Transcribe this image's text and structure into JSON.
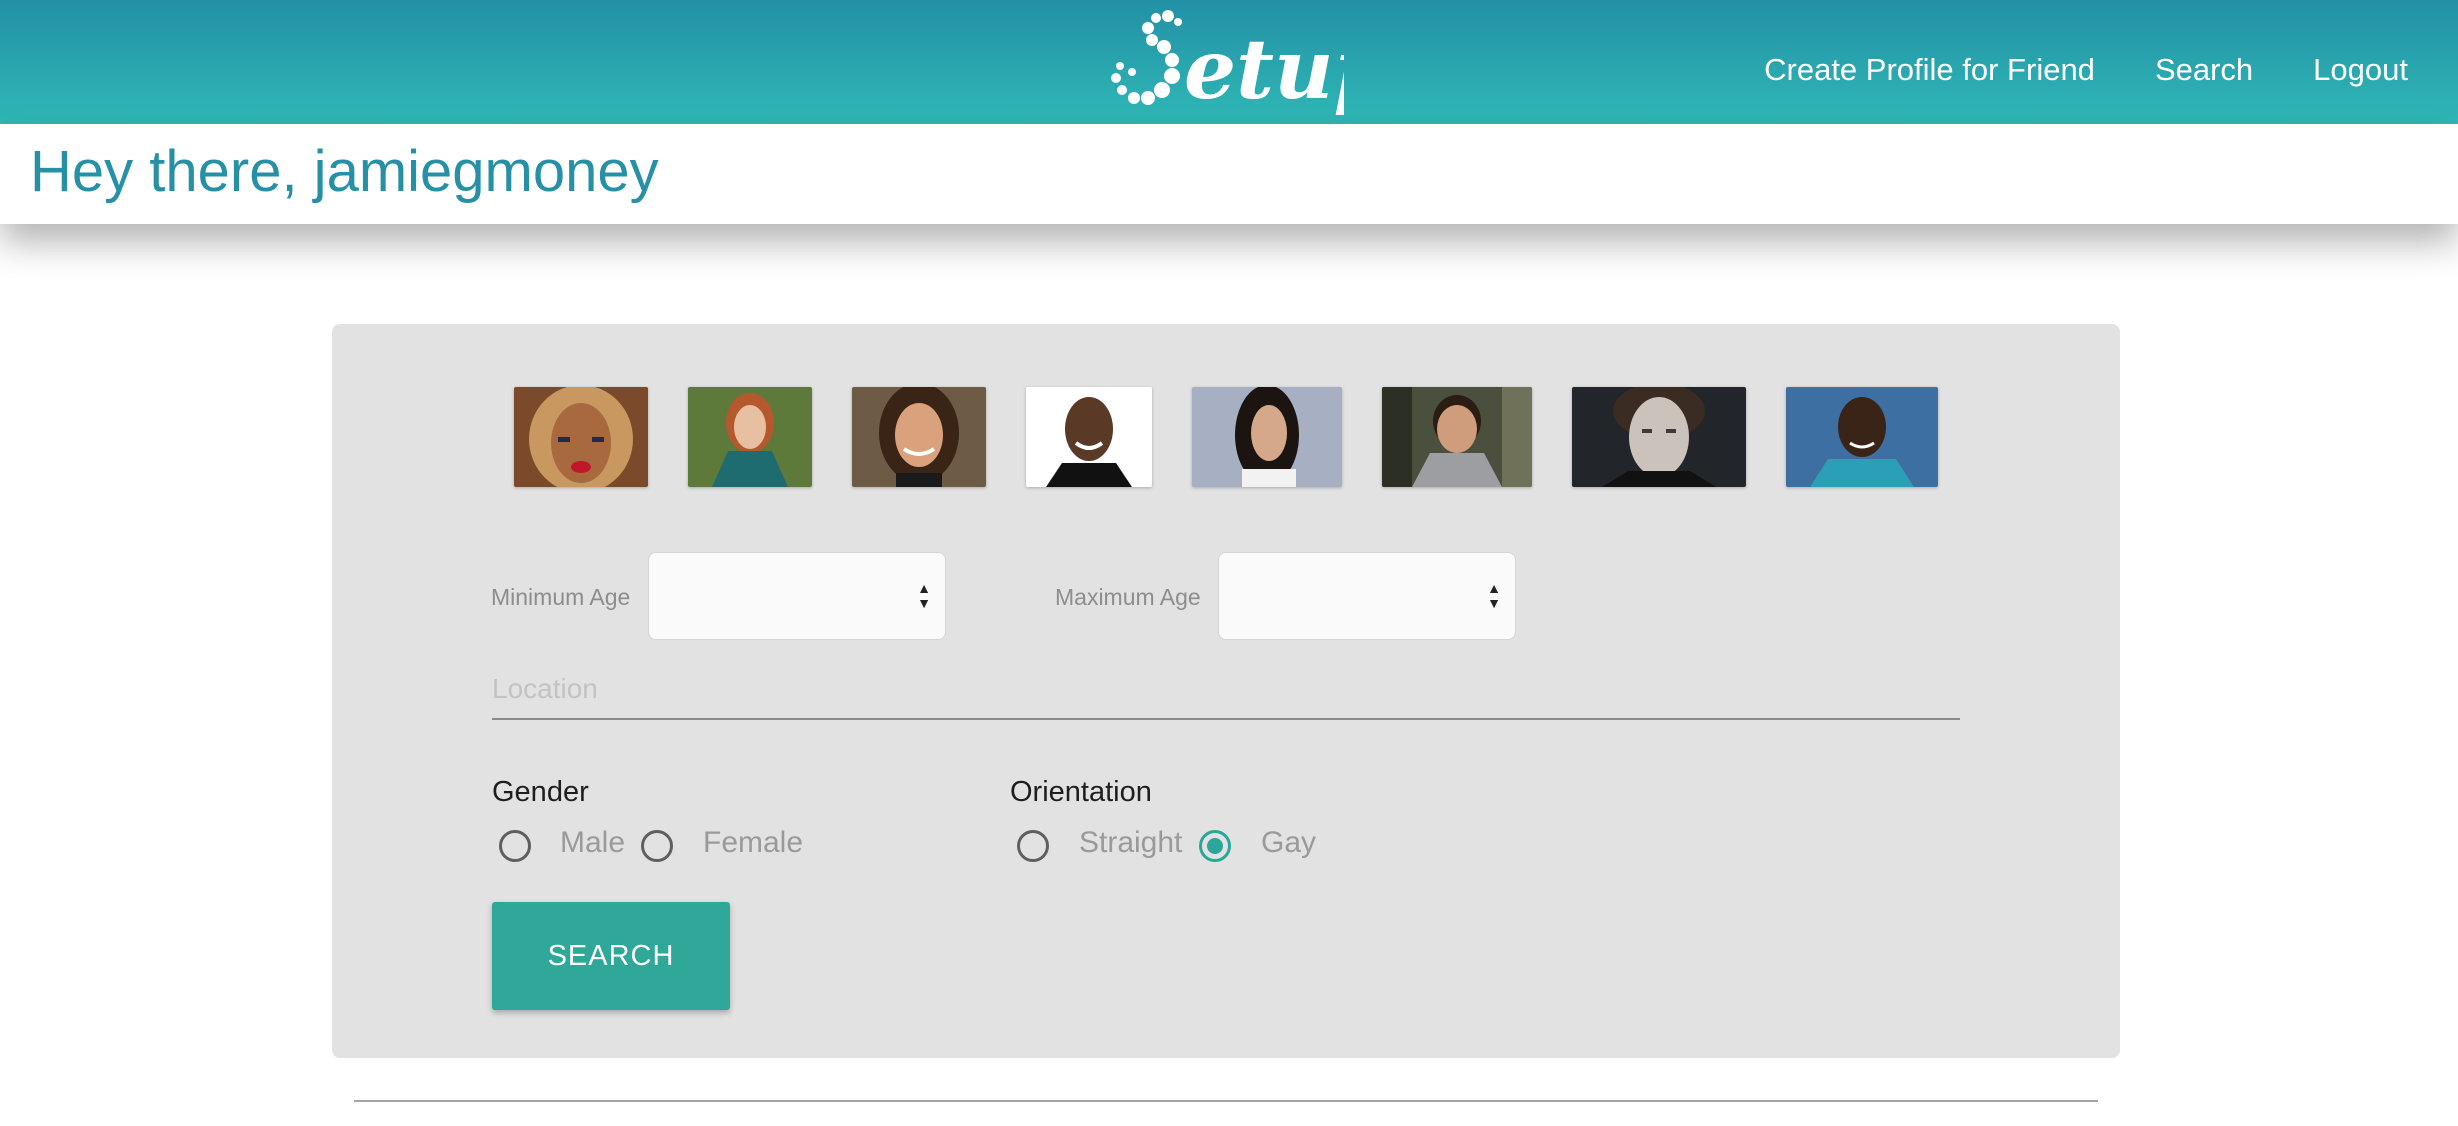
{
  "brand": {
    "logo_text": "Setup",
    "primary_color": "#2b9aab",
    "accent_color": "#2fa799"
  },
  "nav": {
    "links": [
      "Create Profile for Friend",
      "Search",
      "Logout"
    ]
  },
  "greeting": "Hey there, jamiegmoney",
  "photos": [
    {
      "name": "profile-photo-1"
    },
    {
      "name": "profile-photo-2"
    },
    {
      "name": "profile-photo-3"
    },
    {
      "name": "profile-photo-4"
    },
    {
      "name": "profile-photo-5"
    },
    {
      "name": "profile-photo-6"
    },
    {
      "name": "profile-photo-7"
    },
    {
      "name": "profile-photo-8"
    }
  ],
  "filters": {
    "min_age_label": "Minimum Age",
    "min_age_value": "",
    "max_age_label": "Maximum Age",
    "max_age_value": "",
    "location_placeholder": "Location",
    "location_value": "",
    "gender": {
      "label": "Gender",
      "options": [
        "Male",
        "Female"
      ],
      "selected": null
    },
    "orientation": {
      "label": "Orientation",
      "options": [
        "Straight",
        "Gay"
      ],
      "selected": "Gay"
    }
  },
  "search_button": "SEARCH"
}
